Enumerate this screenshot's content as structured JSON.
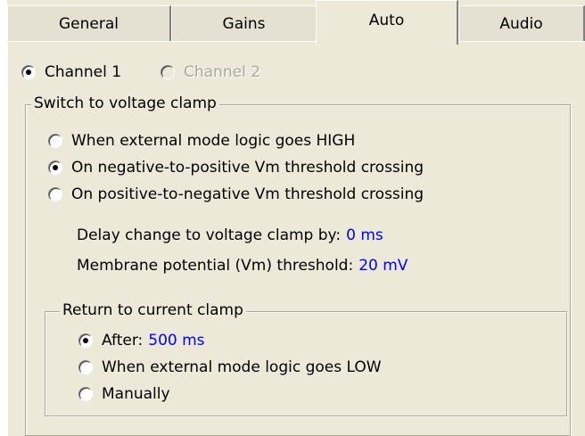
{
  "tabs": [
    "General",
    "Gains",
    "Auto",
    "Audio"
  ],
  "channels": {
    "channel1": "Channel 1",
    "channel2": "Channel 2"
  },
  "switch_group": {
    "title": "Switch to voltage clamp",
    "options": [
      "When external mode logic goes HIGH",
      "On negative-to-positive Vm threshold crossing",
      "On positive-to-negative Vm threshold crossing"
    ],
    "delay_label": "Delay change to voltage clamp by:",
    "delay_value": "0 ms",
    "threshold_label": "Membrane potential (Vm) threshold:",
    "threshold_value": "20 mV"
  },
  "return_group": {
    "title": "Return to current clamp",
    "after_label": "After:",
    "after_value": "500 ms",
    "option_low": "When external mode logic goes LOW",
    "option_manual": "Manually"
  },
  "colors": {
    "accent_value": "#0000ff",
    "panel_bg": "#ece9d8"
  }
}
